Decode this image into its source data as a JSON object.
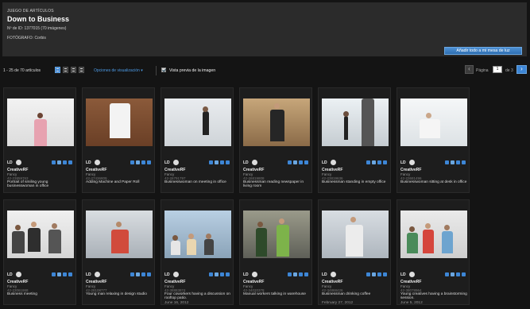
{
  "header": {
    "kicker": "JUEGO DE ARTÍCULOS",
    "title": "Down to Business",
    "id_line": "Nº de ID: 1377015 (70 imágenes)",
    "photographer": "FOTÓGRAFO: Corbis",
    "add_button": "Añadir todo a mi mesa de luz"
  },
  "toolbar": {
    "count": "1 - 25 de 70 artículos",
    "view_options": "Opciones de visualización ▾",
    "preview_label": "Vista previa de la imagen",
    "preview_checked": true
  },
  "pagination": {
    "page_label": "Página",
    "page_value": "1",
    "of_label": "de 3",
    "prev_icon": "chevron-left-icon",
    "next_icon": "chevron-right-icon"
  },
  "cards": [
    {
      "ld": "LD",
      "brand": "CreativeRF",
      "collection": "Fancy",
      "id": "42-23859763",
      "title": "Portrait of smiling young businesswoman in office",
      "date": ""
    },
    {
      "ld": "LD",
      "brand": "CreativeRF",
      "collection": "Fancy",
      "id": "42-27436809",
      "title": "Adding Machine and Paper Roll",
      "date": ""
    },
    {
      "ld": "LD",
      "brand": "CreativeRF",
      "collection": "Fancy",
      "id": "42-26791797",
      "title": "Businesswoman on meeting in office",
      "date": ""
    },
    {
      "ld": "LD",
      "brand": "CreativeRF",
      "collection": "Fancy",
      "id": "42-26819808",
      "title": "Businessman reading newspaper in living room",
      "date": ""
    },
    {
      "ld": "LD",
      "brand": "CreativeRF",
      "collection": "Fancy",
      "id": "42-23819636",
      "title": "Businessman standing in empty office",
      "date": ""
    },
    {
      "ld": "LD",
      "brand": "CreativeRF",
      "collection": "Fancy",
      "id": "42-23681496",
      "title": "Businesswoman sitting at desk in office",
      "date": ""
    },
    {
      "ld": "LD",
      "brand": "CreativeRF",
      "collection": "Fancy",
      "id": "42-23061868",
      "title": "Business meeting",
      "date": ""
    },
    {
      "ld": "LD",
      "brand": "CreativeRF",
      "collection": "Fancy",
      "id": "42-28108777",
      "title": "Young man relaxing in design studio",
      "date": ""
    },
    {
      "ld": "LD",
      "brand": "CreativeRF",
      "collection": "Fancy",
      "id": "42-38883874",
      "title": "Four coworkers having a discussion on rooftop patio.",
      "date": "June 16, 2012"
    },
    {
      "ld": "LD",
      "brand": "CreativeRF",
      "collection": "Fancy",
      "id": "42-34020378",
      "title": "Manual workers talking in warehouse",
      "date": ""
    },
    {
      "ld": "LD",
      "brand": "CreativeRF",
      "collection": "Fancy",
      "id": "42-34868426",
      "title": "Businessman drinking coffee",
      "date": "February 27, 2012"
    },
    {
      "ld": "LD",
      "brand": "CreativeRF",
      "collection": "Fancy",
      "id": "42-38078964",
      "title": "Young creatives having a brainstorming session.",
      "date": "June 5, 2012"
    }
  ],
  "colors": {
    "accent": "#3d86d6",
    "background": "#141414",
    "panel": "#2b2b2b"
  }
}
